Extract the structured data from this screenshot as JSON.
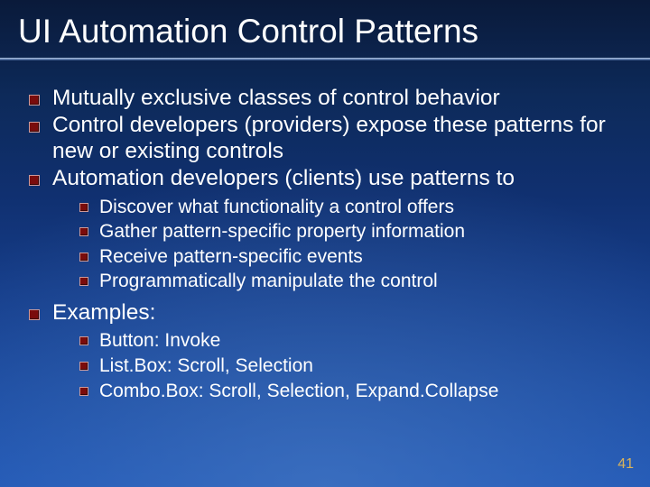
{
  "title": "UI Automation Control Patterns",
  "bullets": {
    "b1": "Mutually exclusive classes of control behavior",
    "b2": "Control developers (providers) expose these patterns for new or existing controls",
    "b3": "Automation developers (clients) use patterns to",
    "b3_sub": {
      "s1": "Discover what functionality a control offers",
      "s2": "Gather pattern-specific property information",
      "s3": "Receive pattern-specific events",
      "s4": "Programmatically manipulate the control"
    },
    "b4": "Examples:",
    "b4_sub": {
      "s1": "Button: Invoke",
      "s2": "List.Box: Scroll, Selection",
      "s3": "Combo.Box: Scroll, Selection, Expand.Collapse"
    }
  },
  "page_number": "41"
}
